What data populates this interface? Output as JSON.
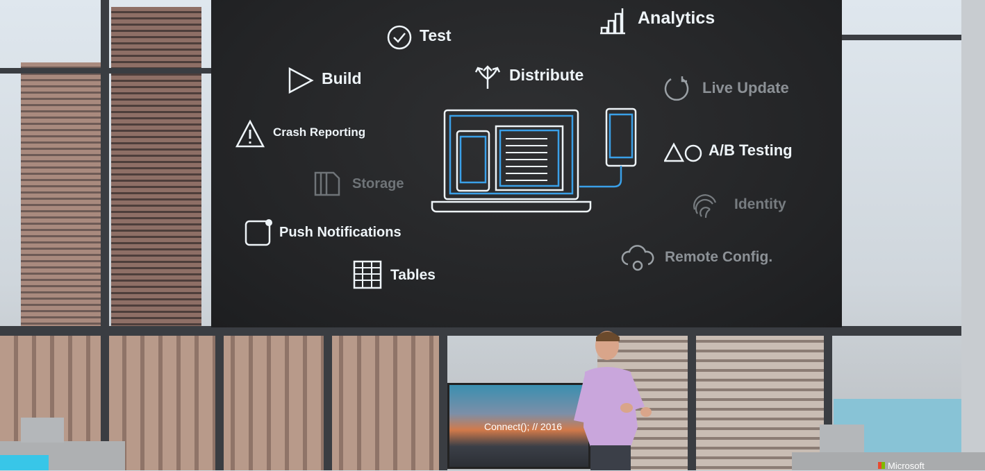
{
  "slide": {
    "features": {
      "test": "Test",
      "analytics": "Analytics",
      "build": "Build",
      "distribute": "Distribute",
      "live_update": "Live Update",
      "crash_reporting": "Crash Reporting",
      "ab_testing": "A/B Testing",
      "storage": "Storage",
      "identity": "Identity",
      "push_notifications": "Push Notifications",
      "remote_config": "Remote Config.",
      "tables": "Tables"
    },
    "colors": {
      "background": "#242527",
      "text": "#eef4f8",
      "dim_text": "#8c9196",
      "accent": "#3aa0e8"
    }
  },
  "tv": {
    "text": "Connect(); // 2016"
  },
  "branding": {
    "logo_text": "Microsoft"
  }
}
